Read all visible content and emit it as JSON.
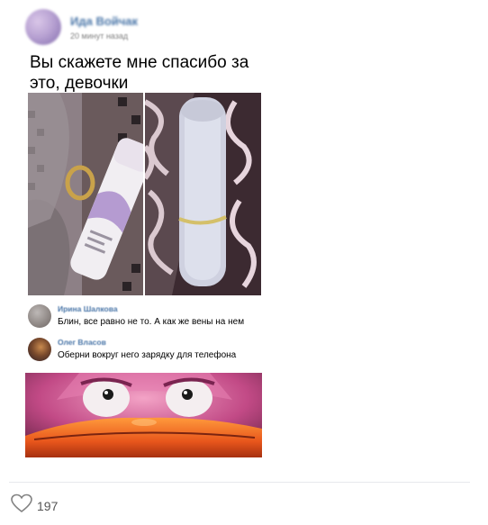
{
  "post": {
    "author": "Ида Войчак",
    "time": "20 минут назад",
    "text": "Вы скажете мне спасибо за это, девочки"
  },
  "comments": [
    {
      "author": "Ирина Шалкова",
      "text": "Блин, все равно не то. А как же вены на нем"
    },
    {
      "author": "Олег Власов",
      "text": "Оберни вокруг него зарядку для телефона"
    }
  ],
  "footer": {
    "likes_count": "197",
    "like_icon": "heart-outline-icon"
  },
  "colors": {
    "link": "#4a76a8",
    "divider": "#e7e8ec",
    "count": "#555555"
  }
}
